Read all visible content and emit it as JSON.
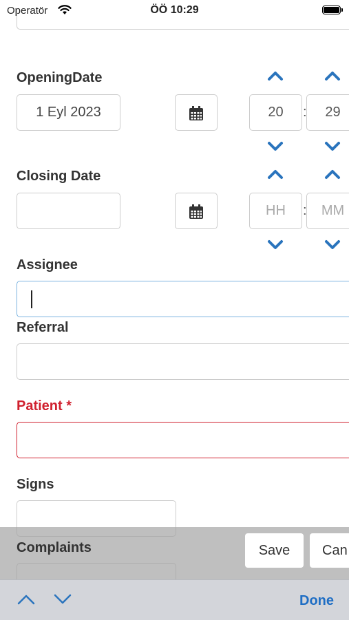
{
  "status_bar": {
    "carrier": "Operatör",
    "time": "ÖÖ 10:29"
  },
  "opening_date": {
    "label": "OpeningDate",
    "date_value": "1 Eyl 2023",
    "hour_value": "20",
    "minute_value": "29"
  },
  "closing_date": {
    "label": "Closing Date",
    "date_value": "",
    "hour_placeholder": "HH",
    "minute_placeholder": "MM"
  },
  "time_separator": ":",
  "assignee": {
    "label": "Assignee",
    "value": ""
  },
  "referral": {
    "label": "Referral",
    "value": ""
  },
  "patient": {
    "label": "Patient *",
    "value": ""
  },
  "signs": {
    "label": "Signs",
    "value": ""
  },
  "complaints": {
    "label": "Complaints",
    "value": ""
  },
  "buttons": {
    "save": "Save",
    "cancel": "Can"
  },
  "keyboard_accessory": {
    "done": "Done"
  },
  "colors": {
    "accent": "#2a74bd",
    "required": "#d0202e",
    "focus_border": "#7ab3e0"
  }
}
